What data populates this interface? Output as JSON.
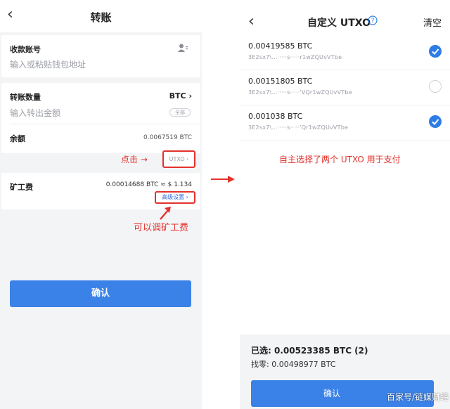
{
  "left": {
    "title": "转账",
    "receive": {
      "label": "收款账号",
      "placeholder": "输入或粘贴钱包地址"
    },
    "amount": {
      "label": "转账数量",
      "unit": "BTC",
      "placeholder": "输入转出金额",
      "all_label": "全部"
    },
    "balance": {
      "label": "余额",
      "value": "0.0067519 BTC"
    },
    "click_note": "点击 →",
    "utxo_link": "UTXO",
    "fee": {
      "label": "矿工费",
      "value": "0.00014688 BTC ≈ $ 1.134",
      "advanced": "高级设置"
    },
    "fee_note": "可以调矿工费",
    "confirm": "确认"
  },
  "right": {
    "title": "自定义 UTXO",
    "clear": "清空",
    "utxos": [
      {
        "amount": "0.00419585 BTC",
        "address": "3E2sx7\\...·····s·····r1wZQUvVTbe",
        "checked": true
      },
      {
        "amount": "0.00151805 BTC",
        "address": "3E2sx7\\...·····s·····'VQr1wZQUvVTbe",
        "checked": false
      },
      {
        "amount": "0.001038 BTC",
        "address": "3E2sx7\\...·····s·····'Qr1wZQUvVTbe",
        "checked": true
      }
    ],
    "auto_note": "自主选择了两个 UTXO 用于支付",
    "selected": "已选: 0.00523385 BTC (2)",
    "change": "找零: 0.00498977 BTC",
    "confirm": "确认",
    "watermark": "百家号/链媒财经"
  },
  "colors": {
    "accent": "#3b82e8",
    "annotation": "#e2322d"
  }
}
